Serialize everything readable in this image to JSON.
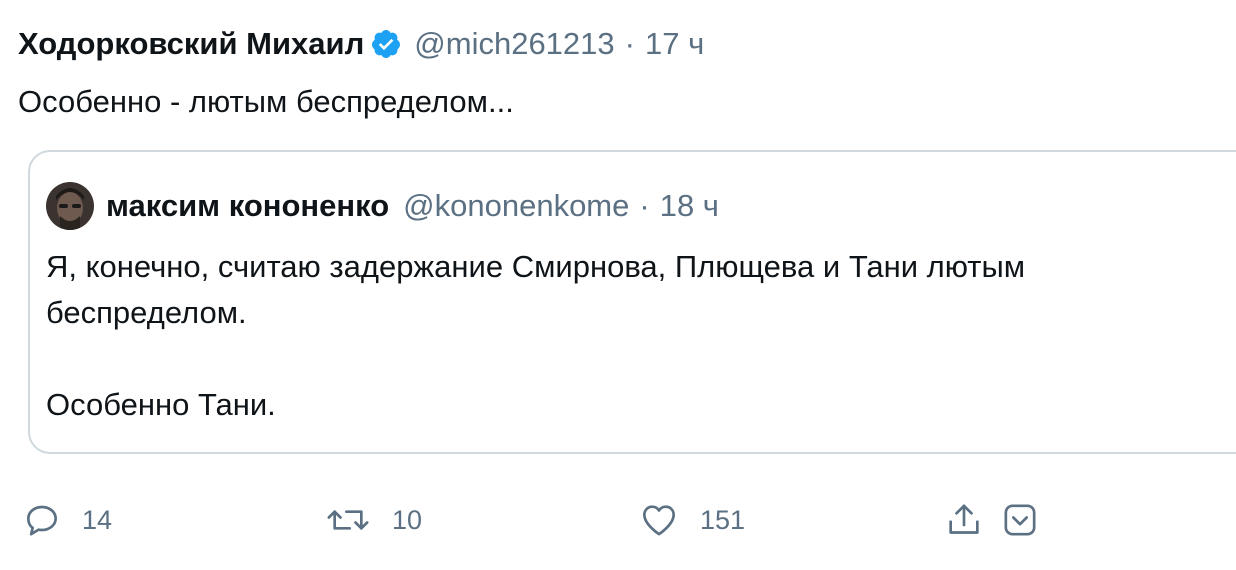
{
  "tweet": {
    "author_name": "Ходорковский Михаил",
    "verified": true,
    "handle": "@mich261213",
    "separator": "·",
    "time": "17 ч",
    "text": "Особенно - лютым беспределом..."
  },
  "quoted_tweet": {
    "author_name": "максим кононенко",
    "handle": "@kononenkome",
    "separator": "·",
    "time": "18 ч",
    "lines": [
      "Я, конечно, считаю задержание Смирнова, Плющева и Тани лютым",
      "беспределом.",
      "",
      "Особенно Тани."
    ]
  },
  "actions": {
    "reply": {
      "icon": "reply-icon",
      "count": "14"
    },
    "retweet": {
      "icon": "retweet-icon",
      "count": "10"
    },
    "like": {
      "icon": "heart-icon",
      "count": "151"
    },
    "share": {
      "icon": "share-icon"
    },
    "more": {
      "icon": "chevron-down-icon"
    }
  },
  "colors": {
    "text": "#0f1419",
    "secondary": "#5b7083",
    "verified": "#1da1f2",
    "border": "#cfd9de"
  }
}
